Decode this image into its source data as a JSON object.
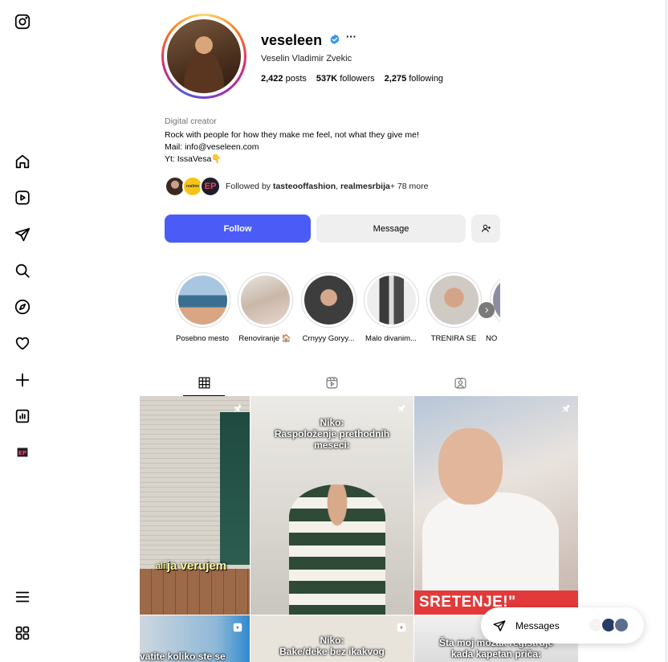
{
  "sidebar": {
    "items": [
      {
        "name": "instagram-logo-icon"
      },
      {
        "name": "home-icon"
      },
      {
        "name": "reels-icon"
      },
      {
        "name": "direct-send-icon"
      },
      {
        "name": "search-icon"
      },
      {
        "name": "explore-icon"
      },
      {
        "name": "notifications-heart-icon"
      },
      {
        "name": "create-plus-icon"
      },
      {
        "name": "dashboard-icon"
      },
      {
        "name": "profile-avatar-icon"
      },
      {
        "name": "more-menu-icon"
      },
      {
        "name": "also-from-meta-icon"
      }
    ]
  },
  "profile": {
    "username": "veseleen",
    "more": "···",
    "full_name": "Veselin Vladimir Zvekic",
    "posts_count": "2,422",
    "posts_label": "posts",
    "followers_count": "537K",
    "followers_label": "followers",
    "following_count": "2,275",
    "following_label": "following",
    "category": "Digital creator",
    "bio_line1": "Rock with people for how they make me feel, not what they give me!",
    "bio_line2": "Mail: info@veseleen.com",
    "bio_line3": "Yt: IssaVesa👇",
    "followed_by_prefix": "Followed by ",
    "followed_by_user1": "tasteooffashion",
    "followed_by_sep": ", ",
    "followed_by_user2": "realmesrbija",
    "followed_by_suffix": " + 78 more",
    "mini_avatar2_text": "realme",
    "mini_avatar3_text": "EP"
  },
  "actions": {
    "follow_label": "Follow",
    "message_label": "Message"
  },
  "highlights": [
    {
      "label": "Posebno mesto"
    },
    {
      "label": "Renoviranje 🏠"
    },
    {
      "label": "Crnyyy Goryy..."
    },
    {
      "label": "Malo divanim..."
    },
    {
      "label": "TRENIRA SE"
    },
    {
      "label": "NO"
    }
  ],
  "tabs": [
    {
      "name": "posts",
      "icon": "grid-icon",
      "active": true
    },
    {
      "name": "reels",
      "icon": "reels-icon",
      "active": false
    },
    {
      "name": "tagged",
      "icon": "tagged-icon",
      "active": false
    }
  ],
  "posts": {
    "p1_caption_small": "ali",
    "p1_caption_big": "ja verujem",
    "p2_caption_line1": "Niko:",
    "p2_caption_line2": "Raspoloženje prethodnih",
    "p2_caption_line3": "meseci:",
    "p3_banner": "SRETENJE!\"",
    "p4_caption": "vatite koliko ste se",
    "p5_caption_line1": "Niko:",
    "p5_caption_line2": "Bake/deke bez ikakvog",
    "p6_caption_line1": "Šta moj mozak registruje",
    "p6_caption_line2": "kada kapetan priča:"
  },
  "messages": {
    "label": "Messages"
  },
  "colors": {
    "primary_button": "#4b5cf6",
    "verified_badge": "#3897f0"
  }
}
